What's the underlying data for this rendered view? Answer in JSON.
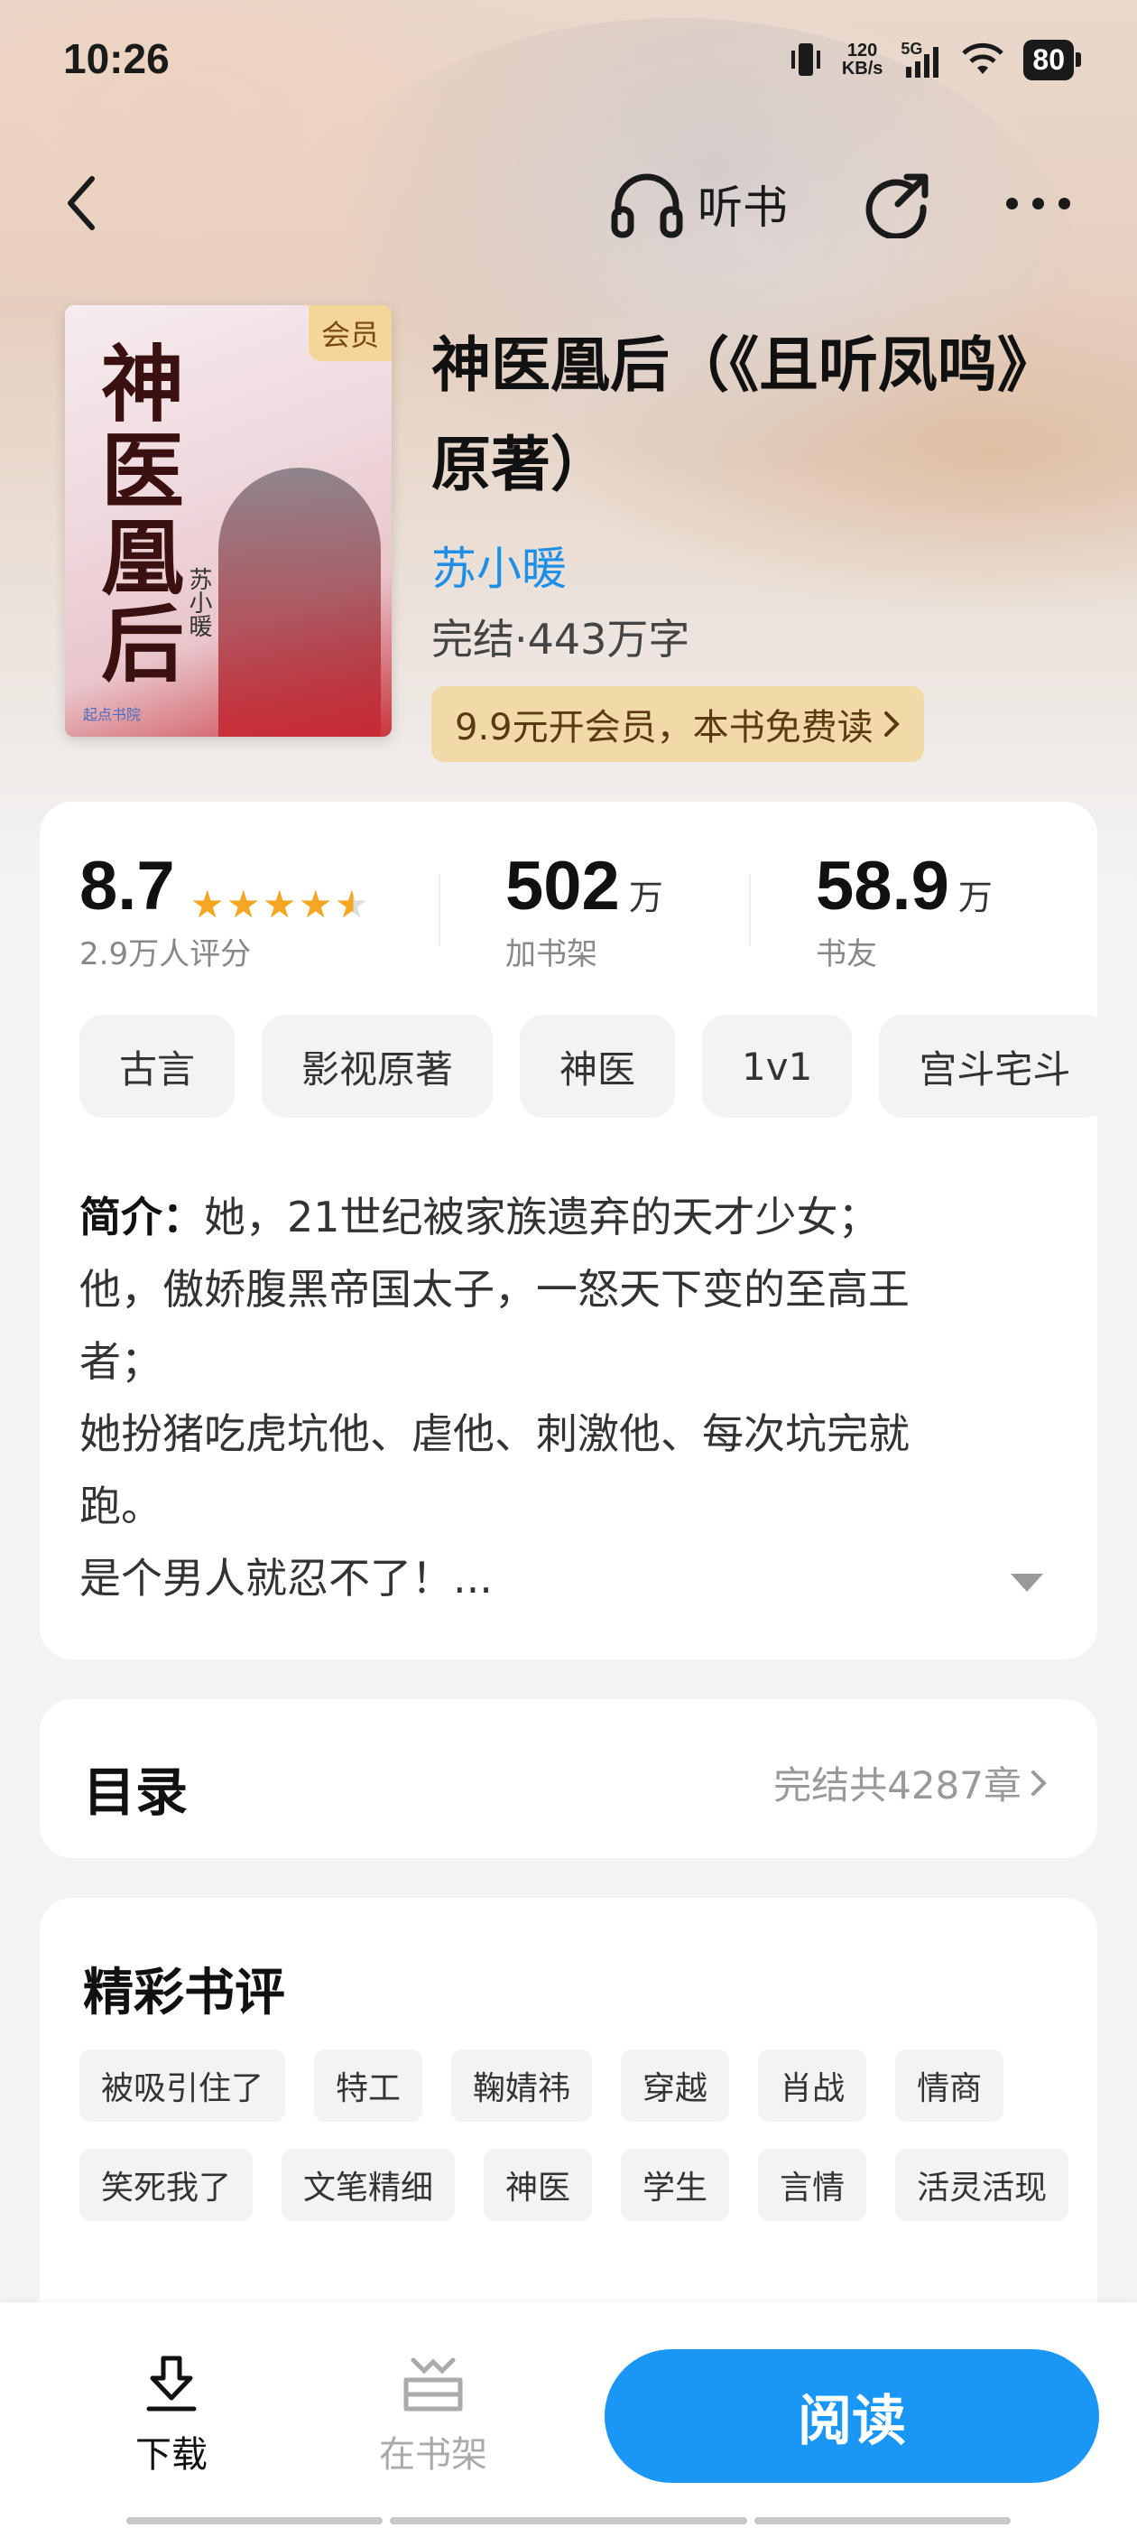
{
  "status_bar": {
    "time": "10:26",
    "net_speed_value": "120",
    "net_speed_unit": "KB/s",
    "signal": "5G",
    "battery": "80"
  },
  "nav": {
    "listen_label": "听书",
    "icons": [
      "back-arrow-icon",
      "headphones-icon",
      "share-icon",
      "more-icon"
    ]
  },
  "book": {
    "title": "神医凰后（《且听凤鸣》原著）",
    "cover_title": "神医凰后",
    "cover_author": "苏小暖",
    "cover_badge": "会员",
    "cover_publisher": "起点书院",
    "author": "苏小暖",
    "meta": "完结·443万字",
    "vip_pill": "9.9元开会员，本书免费读"
  },
  "stats": {
    "rating": "8.7",
    "rating_stars": 4.5,
    "rating_label": "2.9万人评分",
    "shelf_value": "502",
    "shelf_unit": "万",
    "shelf_label": "加书架",
    "fans_value": "58.9",
    "fans_unit": "万",
    "fans_label": "书友"
  },
  "tags": [
    "古言",
    "影视原著",
    "神医",
    "1v1",
    "宫斗宅斗"
  ],
  "intro": {
    "label": "简介：",
    "lines": [
      "她，21世纪被家族遗弃的天才少女；",
      "他，傲娇腹黑帝国太子，一怒天下变的至高王",
      "者；",
      "她扮猪吃虎坑他、虐他、刺激他、每次坑完就",
      "跑。",
      "是个男人就忍不了！..."
    ]
  },
  "toc": {
    "title": "目录",
    "info": "完结共4287章"
  },
  "reviews": {
    "title": "精彩书评",
    "tags": [
      "被吸引住了",
      "特工",
      "鞠婧祎",
      "穿越",
      "肖战",
      "情商",
      "笑死我了",
      "文笔精细",
      "神医",
      "学生",
      "言情",
      "活灵活现"
    ]
  },
  "bottom_bar": {
    "download_label": "下载",
    "shelf_label": "在书架",
    "read_label": "阅读"
  },
  "colors": {
    "accent": "#1a97f5",
    "author_link": "#1e8fe6",
    "star": "#f5a623",
    "vip_pill_bg": "#f1d9a8"
  }
}
